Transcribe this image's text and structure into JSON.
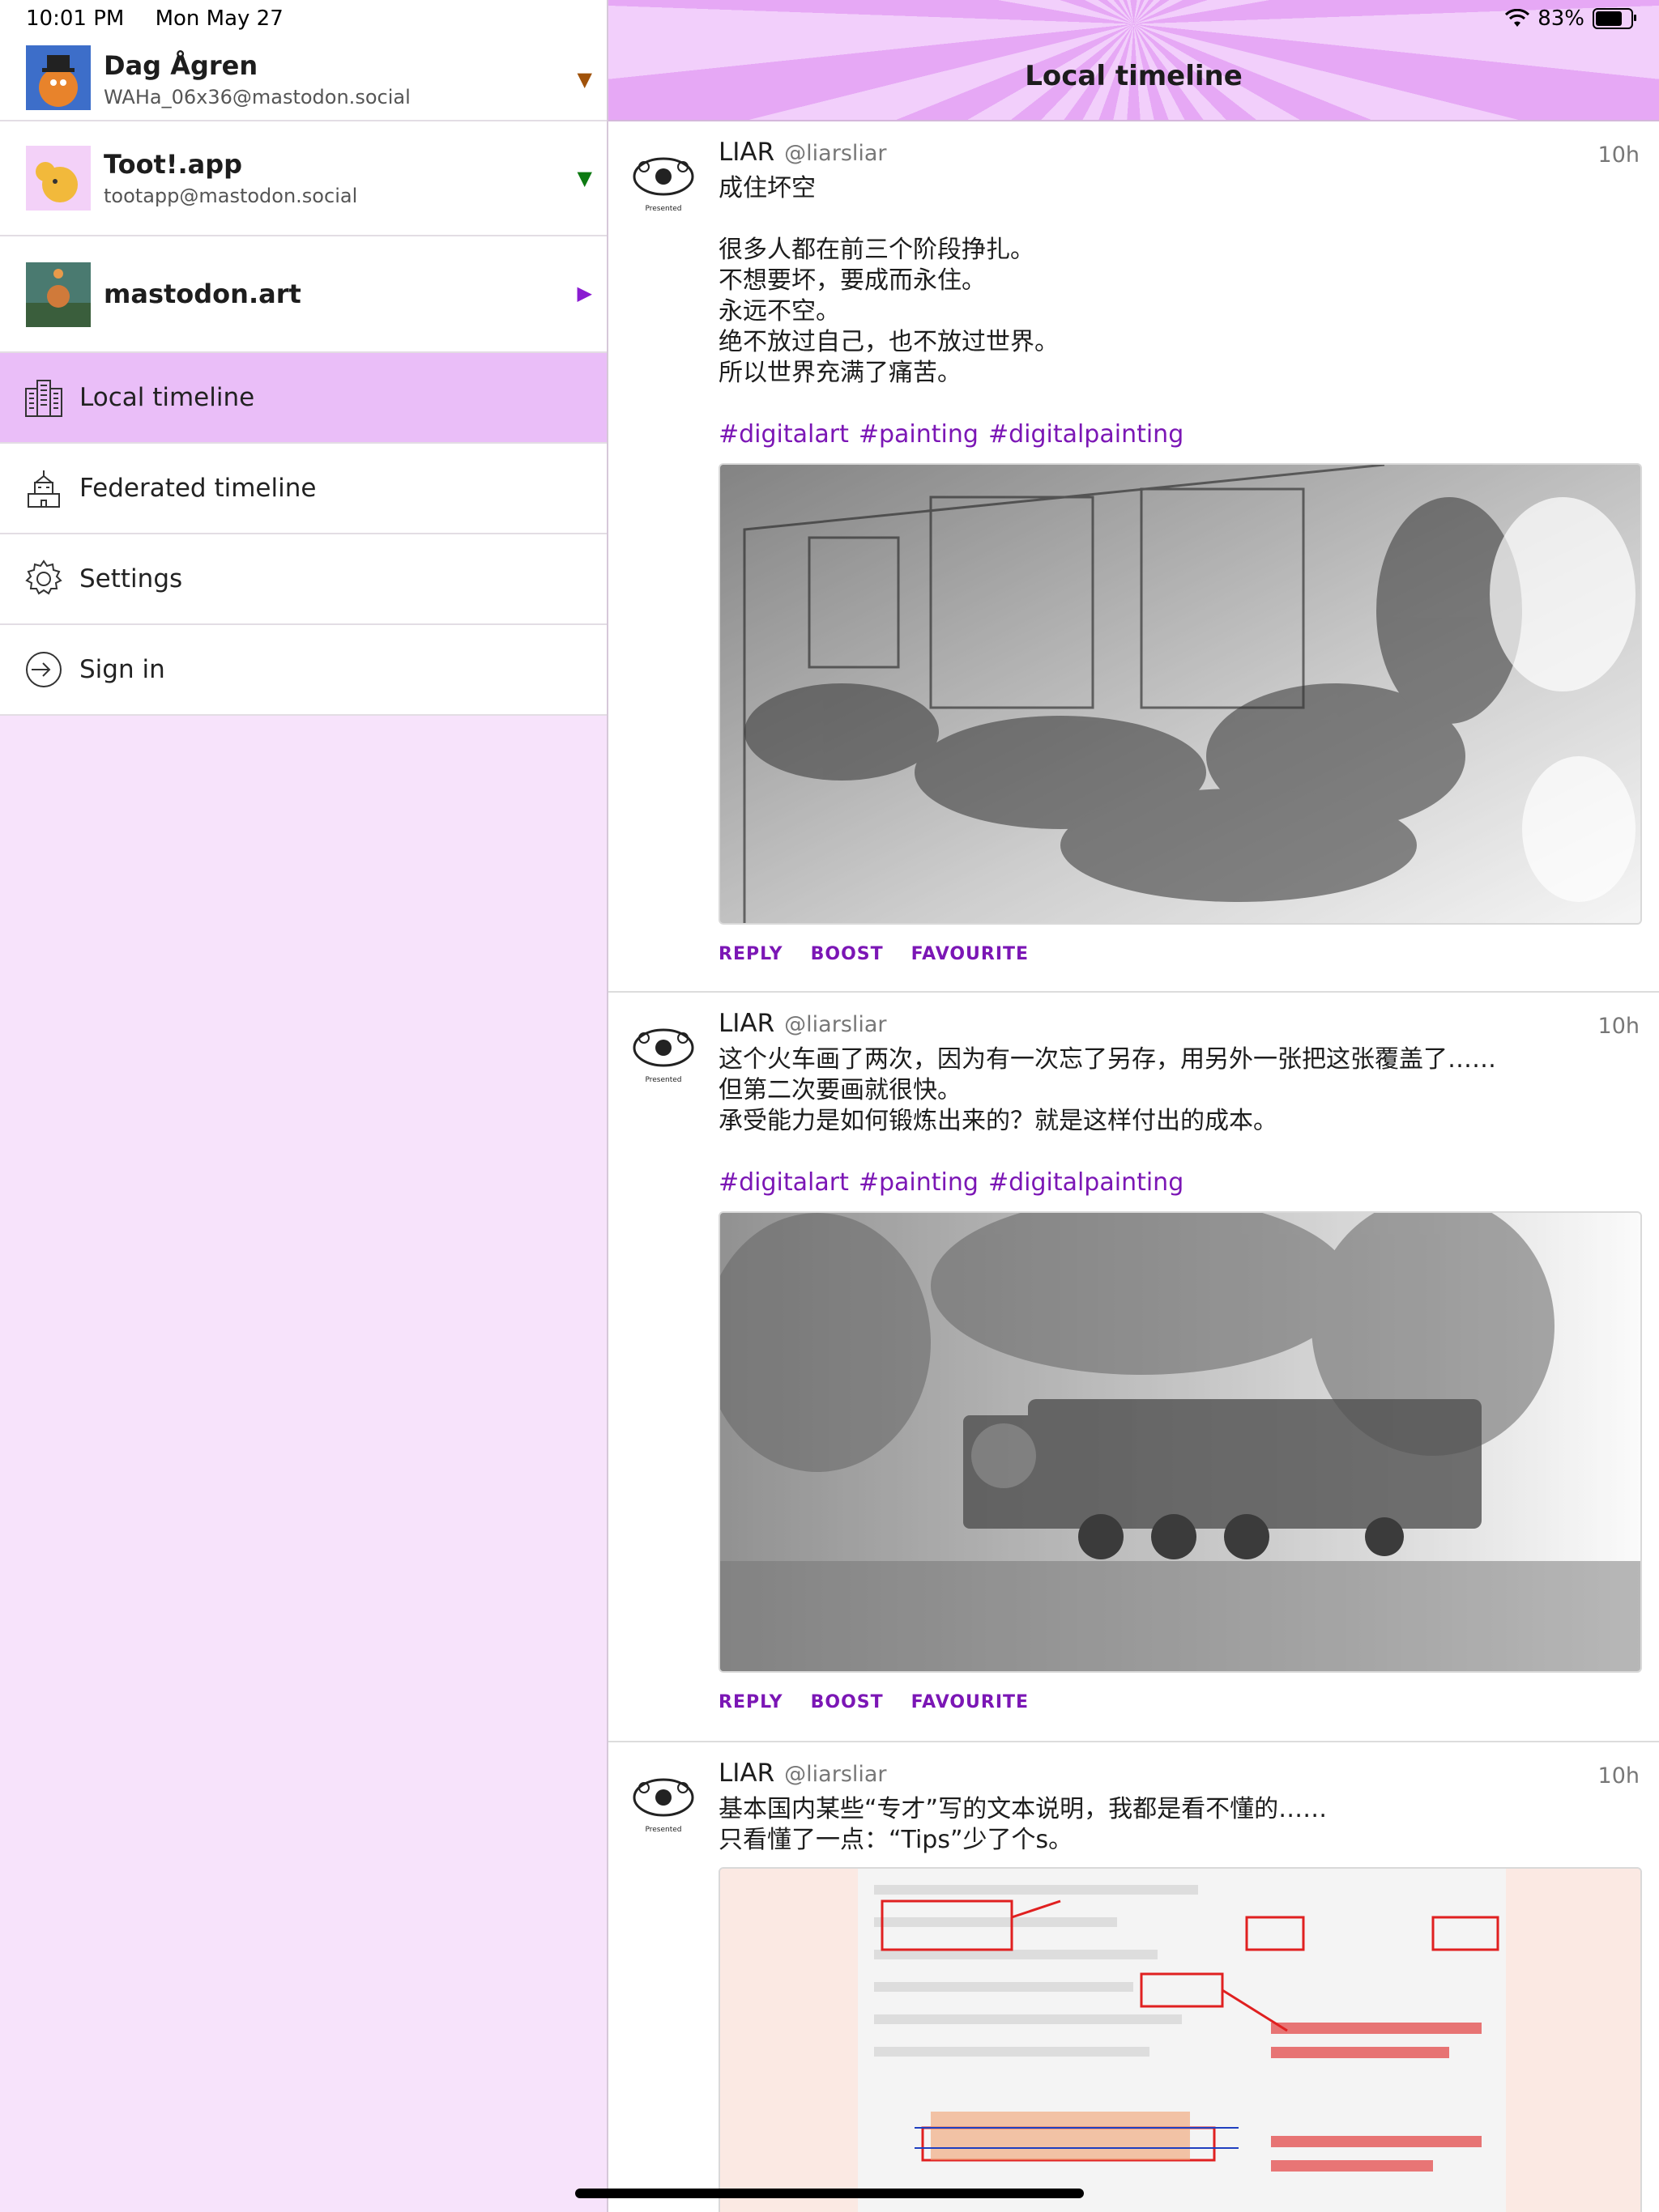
{
  "status_bar": {
    "time": "10:01 PM",
    "date": "Mon May 27",
    "battery": "83%",
    "battery_level": 0.83
  },
  "sidebar": {
    "accounts": [
      {
        "name": "Dag Ågren",
        "handle": "WAHa_06x36@mastodon.social",
        "indicator": "▼",
        "indicator_color": "#a0520a"
      },
      {
        "name": "Toot!.app",
        "handle": "tootapp@mastodon.social",
        "indicator": "▼",
        "indicator_color": "#0d7a12"
      },
      {
        "name": "mastodon.art",
        "handle": "",
        "indicator": "▶",
        "indicator_color": "#8a1bd1"
      }
    ],
    "menu": [
      {
        "label": "Local timeline",
        "icon": "city-icon",
        "active": true
      },
      {
        "label": "Federated timeline",
        "icon": "building-icon",
        "active": false
      },
      {
        "label": "Settings",
        "icon": "gear-icon",
        "active": false
      },
      {
        "label": "Sign in",
        "icon": "sign-in-icon",
        "active": false
      }
    ]
  },
  "header": {
    "title": "Local timeline"
  },
  "actions": {
    "reply": "REPLY",
    "boost": "BOOST",
    "favourite": "FAVOURITE"
  },
  "posts": [
    {
      "author": "LIAR",
      "username": "@liarsliar",
      "time": "10h",
      "lines": [
        "成住坏空",
        "",
        "很多人都在前三个阶段挣扎。",
        "不想要坏，要成而永住。",
        "永远不空。",
        "绝不放过自己，也不放过世界。",
        "所以世界充满了痛苦。",
        ""
      ],
      "tags": [
        "#digitalart",
        "#painting",
        "#digitalpainting"
      ]
    },
    {
      "author": "LIAR",
      "username": "@liarsliar",
      "time": "10h",
      "lines": [
        "这个火车画了两次，因为有一次忘了另存，用另外一张把这张覆盖了……",
        "但第二次要画就很快。",
        "承受能力是如何锻炼出来的？就是这样付出的成本。",
        ""
      ],
      "tags": [
        "#digitalart",
        "#painting",
        "#digitalpainting"
      ]
    },
    {
      "author": "LIAR",
      "username": "@liarsliar",
      "time": "10h",
      "lines": [
        "基本国内某些“专才”写的文本说明，我都是看不懂的……",
        "只看懂了一点：“Tips”少了个s。"
      ],
      "tags": []
    }
  ],
  "colors": {
    "accent": "#7b16b5",
    "sidebar_bg": "#f7e3fb",
    "active_bg": "#eabef8"
  }
}
